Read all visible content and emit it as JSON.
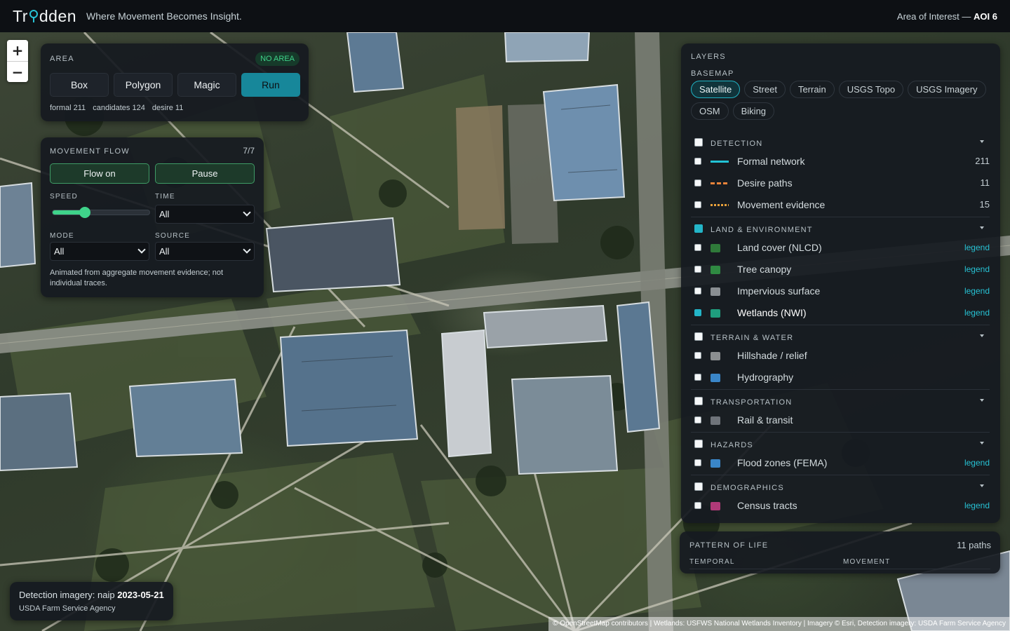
{
  "header": {
    "brand_left": "Tr",
    "brand_right": "dden",
    "brand_icon": "pin-icon",
    "tagline": "Where Movement Becomes Insight.",
    "aoi_label": "Area of Interest —",
    "aoi_value": "AOI 6"
  },
  "zoom": {
    "in": "+",
    "out": "−"
  },
  "area": {
    "title": "AREA",
    "badge": "NO AREA",
    "buttons": [
      "Box",
      "Polygon",
      "Magic",
      "Run"
    ],
    "stats": [
      "formal 211",
      "candidates 124",
      "desire 11"
    ]
  },
  "flow": {
    "title": "MOVEMENT FLOW",
    "count": "7/7",
    "flow_on": "Flow on",
    "pause": "Pause",
    "speed_label": "SPEED",
    "speed_value": 0.33,
    "time_label": "TIME",
    "time_value": "All",
    "mode_label": "MODE",
    "mode_value": "All",
    "source_label": "SOURCE",
    "source_value": "All",
    "note": "Animated from aggregate movement evidence; not individual traces."
  },
  "detection": {
    "line1_prefix": "Detection imagery: naip",
    "line1_date": "2023-05-21",
    "line2": "USDA Farm Service Agency"
  },
  "layers": {
    "title": "LAYERS",
    "basemap_title": "BASEMAP",
    "basemaps": [
      {
        "label": "Satellite",
        "active": true
      },
      {
        "label": "Street"
      },
      {
        "label": "Terrain"
      },
      {
        "label": "USGS Topo"
      },
      {
        "label": "USGS Imagery"
      },
      {
        "label": "OSM"
      },
      {
        "label": "Biking"
      }
    ],
    "groups": [
      {
        "title": "DETECTION",
        "rows": [
          {
            "name": "Formal network",
            "count": "211",
            "swatch": "#22c3d6",
            "style": "solid"
          },
          {
            "name": "Desire paths",
            "count": "11",
            "swatch": "#e8833a",
            "style": "dashed"
          },
          {
            "name": "Movement evidence",
            "count": "15",
            "swatch": "#e8a03a",
            "style": "dotted"
          }
        ]
      },
      {
        "title": "LAND & ENVIRONMENT",
        "rows": [
          {
            "name": "Land cover (NLCD)",
            "legend": "legend",
            "swatch": "#2f7a3a"
          },
          {
            "name": "Tree canopy",
            "legend": "legend",
            "swatch": "#2f8a42"
          },
          {
            "name": "Impervious surface",
            "legend": "legend",
            "swatch": "#8a8f93"
          },
          {
            "name": "Wetlands (NWI)",
            "legend": "legend",
            "swatch": "#1f9e7e",
            "checked": true
          }
        ]
      },
      {
        "title": "TERRAIN & WATER",
        "rows": [
          {
            "name": "Hillshade / relief",
            "swatch": "#8c8f91"
          },
          {
            "name": "Hydrography",
            "swatch": "#3a86c8"
          }
        ]
      },
      {
        "title": "TRANSPORTATION",
        "rows": [
          {
            "name": "Rail & transit",
            "swatch": "#6f747a"
          }
        ]
      },
      {
        "title": "HAZARDS",
        "rows": [
          {
            "name": "Flood zones (FEMA)",
            "legend": "legend",
            "swatch": "#3a86c8"
          }
        ]
      },
      {
        "title": "DEMOGRAPHICS",
        "rows": [
          {
            "name": "Census tracts",
            "legend": "legend",
            "swatch": "#b03a78"
          }
        ]
      }
    ]
  },
  "pattern": {
    "title": "PATTERN OF LIFE",
    "paths": "11 paths",
    "temporal": "TEMPORAL",
    "movement": "MOVEMENT"
  },
  "attribution": "© OpenStreetMap contributors | Wetlands: USFWS National Wetlands Inventory | Imagery © Esri, Detection imagery: USDA Farm Service Agency"
}
